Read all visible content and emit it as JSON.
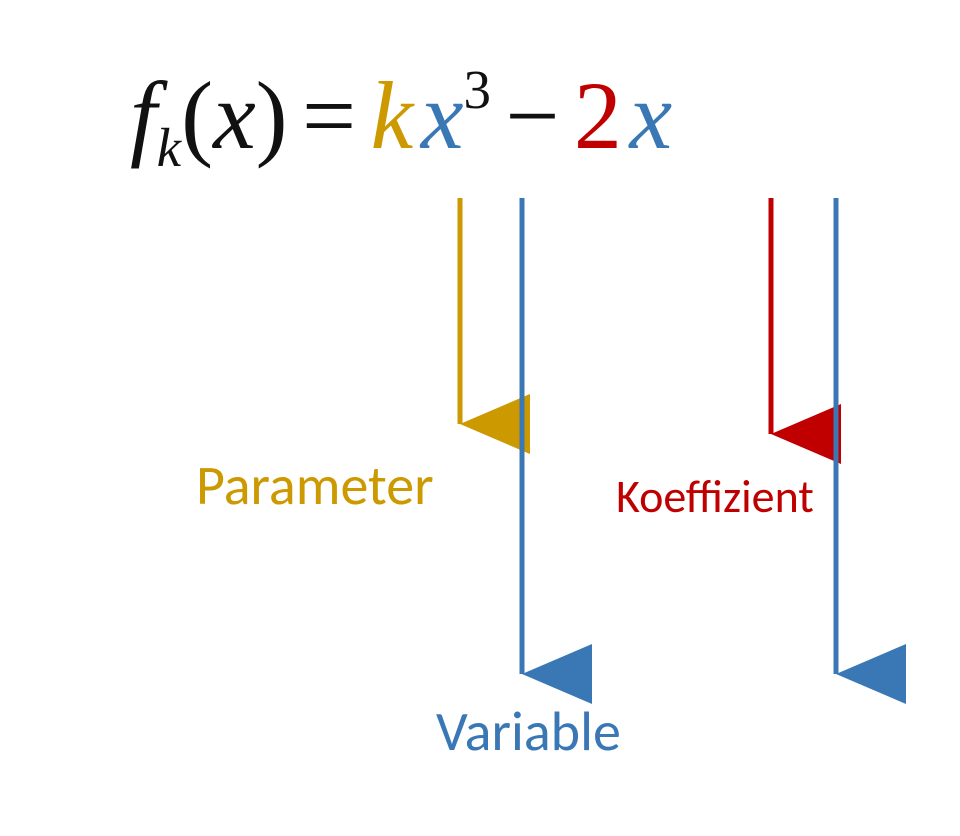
{
  "equation": {
    "f": "f",
    "subk": "k",
    "open": "(",
    "x_arg": "x",
    "close": ")",
    "eq": "=",
    "k": "k",
    "x1": "x",
    "sup3": "3",
    "minus": "−",
    "two": "2",
    "x2": "x"
  },
  "labels": {
    "parameter": "Parameter",
    "koeffizient": "Koeffizient",
    "variable": "Variable"
  },
  "colors": {
    "parameter": "#cc9900",
    "variable": "#3a78b5",
    "coefficient": "#c00000",
    "ink": "#111111"
  }
}
